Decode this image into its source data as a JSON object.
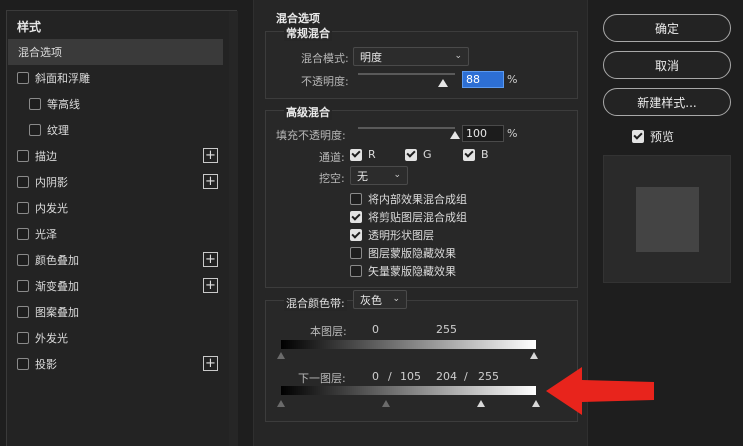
{
  "styles_panel": {
    "header": "样式",
    "items": [
      {
        "label": "混合选项",
        "checkbox": false,
        "selected": true,
        "indent": false,
        "plus": false
      },
      {
        "label": "斜面和浮雕",
        "checkbox": true,
        "checked": false,
        "indent": false,
        "plus": false
      },
      {
        "label": "等高线",
        "checkbox": true,
        "checked": false,
        "indent": true,
        "plus": false
      },
      {
        "label": "纹理",
        "checkbox": true,
        "checked": false,
        "indent": true,
        "plus": false
      },
      {
        "label": "描边",
        "checkbox": true,
        "checked": false,
        "indent": false,
        "plus": true
      },
      {
        "label": "内阴影",
        "checkbox": true,
        "checked": false,
        "indent": false,
        "plus": true
      },
      {
        "label": "内发光",
        "checkbox": true,
        "checked": false,
        "indent": false,
        "plus": false
      },
      {
        "label": "光泽",
        "checkbox": true,
        "checked": false,
        "indent": false,
        "plus": false
      },
      {
        "label": "颜色叠加",
        "checkbox": true,
        "checked": false,
        "indent": false,
        "plus": true
      },
      {
        "label": "渐变叠加",
        "checkbox": true,
        "checked": false,
        "indent": false,
        "plus": true
      },
      {
        "label": "图案叠加",
        "checkbox": true,
        "checked": false,
        "indent": false,
        "plus": false
      },
      {
        "label": "外发光",
        "checkbox": true,
        "checked": false,
        "indent": false,
        "plus": false
      },
      {
        "label": "投影",
        "checkbox": true,
        "checked": false,
        "indent": false,
        "plus": true
      }
    ]
  },
  "blending": {
    "section_title": "混合选项",
    "general": {
      "title": "常规混合",
      "blend_mode_label": "混合模式:",
      "blend_mode_value": "明度",
      "opacity_label": "不透明度:",
      "opacity_value": "88",
      "opacity_unit": "%",
      "opacity_fraction": 0.88
    },
    "advanced": {
      "title": "高级混合",
      "fill_opacity_label": "填充不透明度:",
      "fill_opacity_value": "100",
      "fill_opacity_unit": "%",
      "fill_opacity_fraction": 1.0,
      "channels_label": "通道:",
      "channels": [
        {
          "label": "R",
          "checked": true
        },
        {
          "label": "G",
          "checked": true
        },
        {
          "label": "B",
          "checked": true
        }
      ],
      "knockout_label": "挖空:",
      "knockout_value": "无",
      "options": [
        {
          "label": "将内部效果混合成组",
          "checked": false
        },
        {
          "label": "将剪贴图层混合成组",
          "checked": true
        },
        {
          "label": "透明形状图层",
          "checked": true
        },
        {
          "label": "图层蒙版隐藏效果",
          "checked": false
        },
        {
          "label": "矢量蒙版隐藏效果",
          "checked": false
        }
      ]
    },
    "blend_if": {
      "label": "混合颜色带:",
      "value": "灰色",
      "this_layer_label": "本图层:",
      "this_layer_low": "0",
      "this_layer_high": "255",
      "underlying_label": "下一图层:",
      "underlying_low_a": "0",
      "underlying_low_sep": "/",
      "underlying_low_b": "105",
      "underlying_high_a": "204",
      "underlying_high_sep": "/",
      "underlying_high_b": "255"
    }
  },
  "buttons": {
    "ok": "确定",
    "cancel": "取消",
    "new_style": "新建样式...",
    "preview_label": "预览",
    "preview_checked": true
  },
  "colors": {
    "annotation_arrow": "#e8241c",
    "focus_blue": "#2d6fd4"
  }
}
